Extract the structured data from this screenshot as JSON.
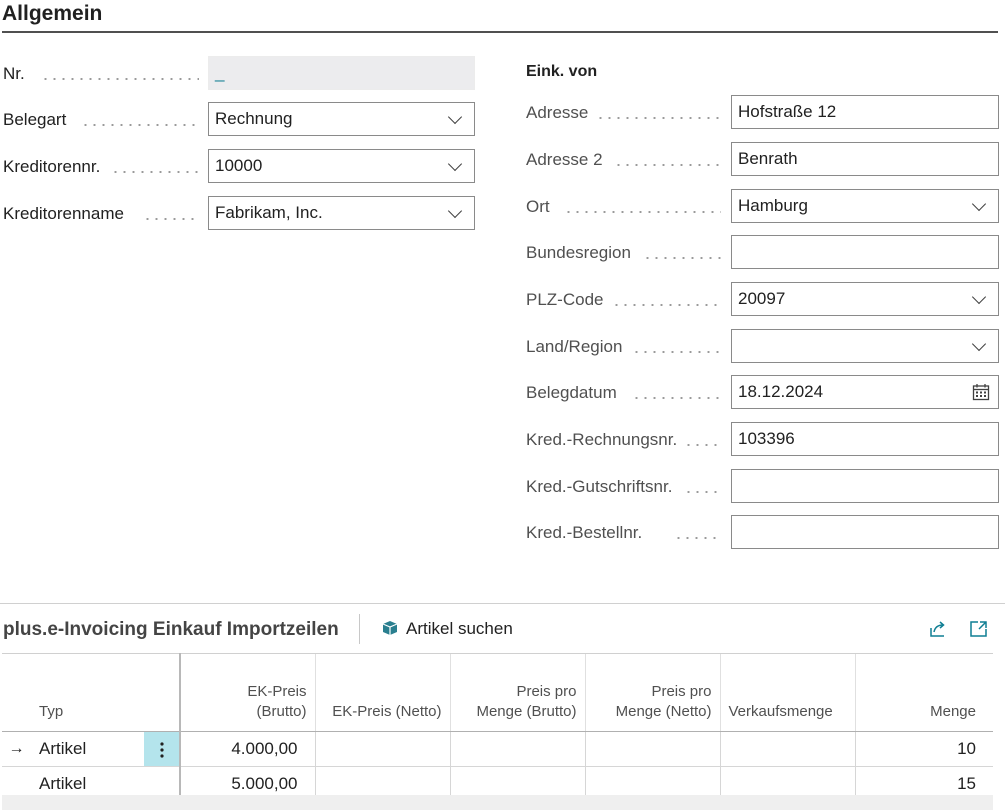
{
  "section_title": "Allgemein",
  "left_fields": {
    "nr": {
      "label": "Nr.",
      "value": "_"
    },
    "belegart": {
      "label": "Belegart",
      "value": "Rechnung"
    },
    "kreditorennr": {
      "label": "Kreditorennr.",
      "value": "10000"
    },
    "kreditorenname": {
      "label": "Kreditorenname",
      "value": "Fabrikam, Inc."
    }
  },
  "eink_von": {
    "heading": "Eink. von",
    "adresse": {
      "label": "Adresse",
      "value": "Hofstraße 12"
    },
    "adresse2": {
      "label": "Adresse 2",
      "value": "Benrath"
    },
    "ort": {
      "label": "Ort",
      "value": "Hamburg"
    },
    "bundesregion": {
      "label": "Bundesregion",
      "value": ""
    },
    "plz": {
      "label": "PLZ-Code",
      "value": "20097"
    },
    "land": {
      "label": "Land/Region",
      "value": ""
    },
    "belegdatum": {
      "label": "Belegdatum",
      "value": "18.12.2024"
    },
    "rechnungsnr": {
      "label": "Kred.-Rechnungsnr.",
      "value": "103396"
    },
    "gutschriftsnr": {
      "label": "Kred.-Gutschriftsnr.",
      "value": ""
    },
    "bestellnr": {
      "label": "Kred.-Bestellnr.",
      "value": ""
    }
  },
  "lines_part": {
    "title": "plus.e-Invoicing Einkauf Importzeilen",
    "action_label": "Artikel suchen",
    "icons": {
      "action": "box-icon",
      "share": "share-icon",
      "expand": "expand-icon"
    }
  },
  "grid": {
    "headers": {
      "typ": "Typ",
      "ek_brutto_1": "EK-Preis",
      "ek_brutto_2": "(Brutto)",
      "ek_netto": "EK-Preis (Netto)",
      "ppm_brutto_1": "Preis pro",
      "ppm_brutto_2": "Menge (Brutto)",
      "ppm_netto_1": "Preis pro",
      "ppm_netto_2": "Menge (Netto)",
      "verkaufsmenge": "Verkaufsmenge",
      "menge": "Menge"
    },
    "rows": [
      {
        "selector": "→",
        "typ": "Artikel",
        "ek_brutto": "4.000,00",
        "ek_netto": "",
        "ppm_brutto": "",
        "ppm_netto": "",
        "verkaufsmenge": "",
        "menge": "10"
      },
      {
        "selector": "",
        "typ": "Artikel",
        "ek_brutto": "5.000,00",
        "ek_netto": "",
        "ppm_brutto": "",
        "ppm_netto": "",
        "verkaufsmenge": "",
        "menge": "15"
      }
    ]
  },
  "colors": {
    "accent": "#0f7e93",
    "selected_cell": "#b4e4ec",
    "readonly_bg": "#ececee"
  }
}
